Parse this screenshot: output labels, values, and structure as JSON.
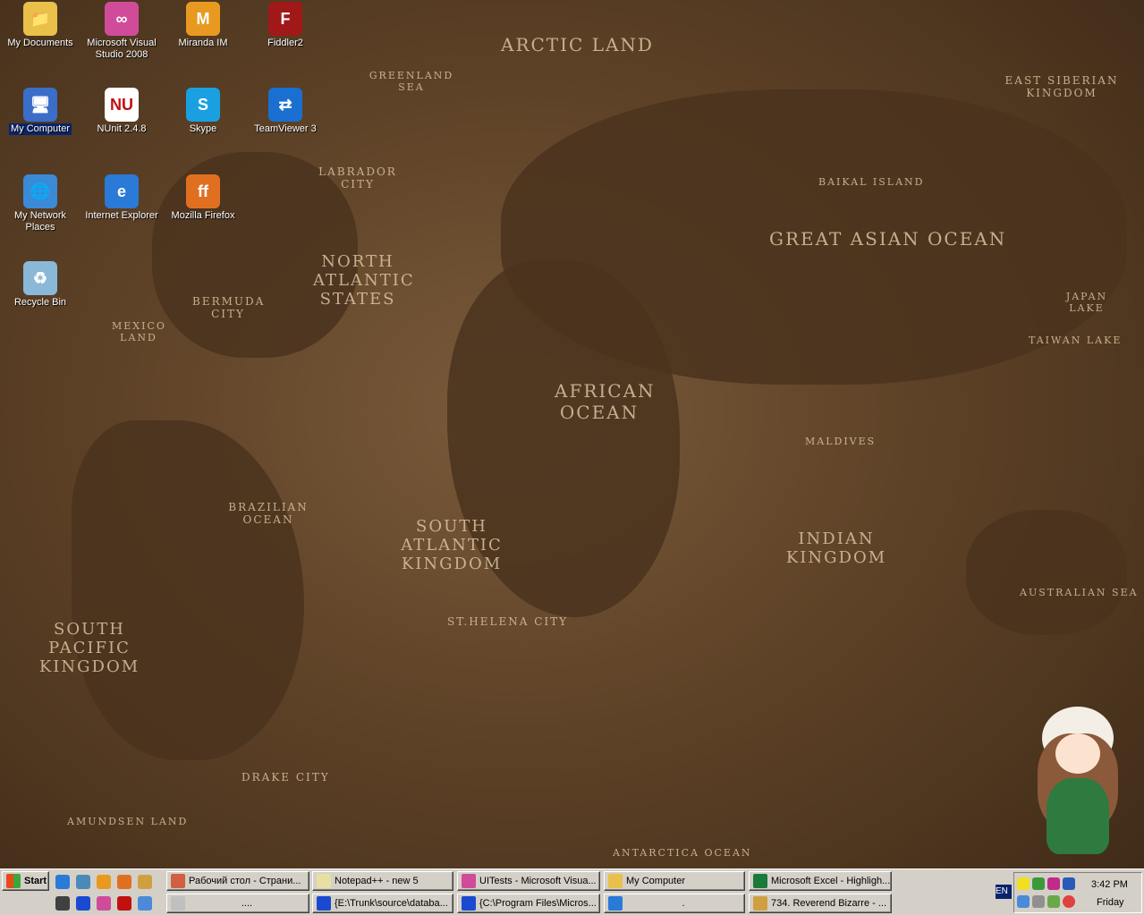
{
  "wallpaper": {
    "labels": [
      "ARCTIC LAND",
      "GREAT ASIAN OCEAN",
      "AFRICAN OCEAN",
      "NORTH ATLANTIC STATES",
      "SOUTH ATLANTIC KINGDOM",
      "INDIAN KINGDOM",
      "SOUTH PACIFIC KINGDOM",
      "BRAZILIAN OCEAN",
      "EAST SIBERIAN KINGDOM",
      "LABRADOR CITY",
      "BERMUDA CITY",
      "DRAKE CITY",
      "ST.HELENA CITY",
      "AUSTRALIAN SEA",
      "ANTARCTICA OCEAN",
      "AMUNDSEN LAND",
      "MALDIVES",
      "JAPAN LAKE",
      "TAIWAN LAKE",
      "BAIKAL ISLAND",
      "GREENLAND SEA",
      "MEXICO LAND"
    ]
  },
  "desktop": {
    "icons": [
      {
        "label": "My Documents",
        "color": "#e8c04a",
        "glyph": "📁"
      },
      {
        "label": "Microsoft Visual Studio 2008",
        "color": "#d04c9a",
        "glyph": "∞"
      },
      {
        "label": "Miranda IM",
        "color": "#e89a20",
        "glyph": "M"
      },
      {
        "label": "Fiddler2",
        "color": "#a01818",
        "glyph": "F"
      },
      {
        "label": "My Computer",
        "color": "#3a6ec8",
        "glyph": "🖥"
      },
      {
        "label": "NUnit 2.4.8",
        "color": "#ffffff",
        "glyph": "NU"
      },
      {
        "label": "Skype",
        "color": "#1aa0e0",
        "glyph": "S"
      },
      {
        "label": "TeamViewer 3",
        "color": "#1a70d0",
        "glyph": "⇄"
      },
      {
        "label": "My Network Places",
        "color": "#3a8ad8",
        "glyph": "🌐"
      },
      {
        "label": "Internet Explorer",
        "color": "#2a7ad8",
        "glyph": "e"
      },
      {
        "label": "Mozilla Firefox",
        "color": "#e07020",
        "glyph": "ff"
      },
      {
        "label": "Recycle Bin",
        "color": "#8ab8d8",
        "glyph": "♻"
      }
    ]
  },
  "taskbar": {
    "start_label": "Start",
    "quick_launch": [
      "internet-explorer",
      "outlook",
      "miranda",
      "firefox",
      "winamp",
      "resharper",
      "totalcmd",
      "visual-studio",
      "nunit",
      "network"
    ],
    "tasks": [
      {
        "label": "Рабочий стол - Страни...",
        "color": "#d06040"
      },
      {
        "label": "Notepad++ - new 5",
        "color": "#e8e0a0"
      },
      {
        "label": "UITests - Microsoft Visua...",
        "color": "#d04c9a"
      },
      {
        "label": "My Computer",
        "color": "#e8c04a"
      },
      {
        "label": "Microsoft Excel - Highligh...",
        "color": "#1a7a3a"
      },
      {
        "label": "....",
        "color": "#c0c0c0"
      },
      {
        "label": "{E:\\Trunk\\source\\databa...",
        "color": "#1a4ad0"
      },
      {
        "label": "{C:\\Program Files\\Micros...",
        "color": "#1a4ad0"
      },
      {
        "label": ".",
        "color": "#2a7ad8"
      },
      {
        "label": "734. Reverend Bizarre - ...",
        "color": "#d0a040"
      }
    ],
    "language": "EN",
    "clock": {
      "time": "3:42 PM",
      "day": "Friday"
    }
  }
}
